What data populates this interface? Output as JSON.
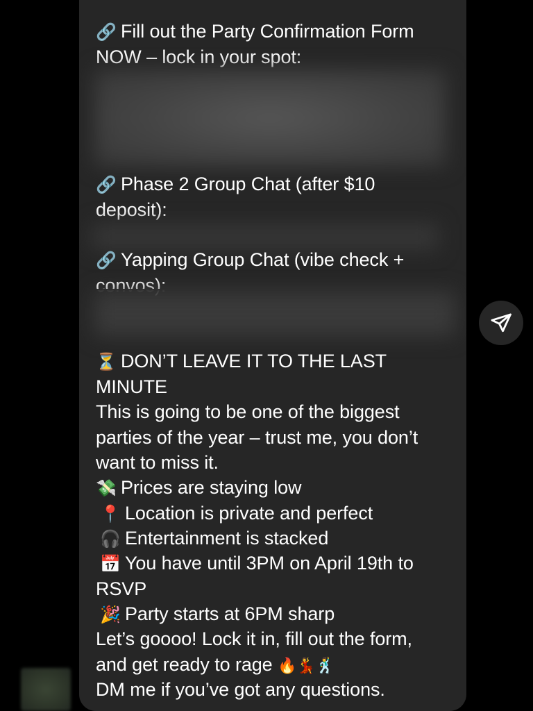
{
  "message": {
    "lines": [
      {
        "icon": "🔗",
        "text": "Fill out the Party Confirmation Form"
      },
      {
        "icon": "",
        "text": "NOW – lock in your spot:"
      },
      {
        "icon": "🔗",
        "text": "Phase 2 Group Chat (after $10"
      },
      {
        "icon": "",
        "text": "deposit):"
      },
      {
        "icon": "🔗",
        "text": "Yapping Group Chat (vibe check +"
      },
      {
        "icon": "",
        "text": "convos):"
      },
      {
        "icon": "⏳",
        "text": "DON’T LEAVE IT TO THE LAST"
      },
      {
        "icon": "",
        "text": "MINUTE"
      },
      {
        "icon": "",
        "text": "This is going to be one of the biggest"
      },
      {
        "icon": "",
        "text": "parties of the year – trust me, you don’t"
      },
      {
        "icon": "",
        "text": "want to miss it."
      },
      {
        "icon": "💸",
        "text": "Prices are staying low"
      },
      {
        "icon": "📍",
        "text": "Location is private and perfect"
      },
      {
        "icon": "🎧",
        "text": "Entertainment is stacked"
      },
      {
        "icon": "📅",
        "text": "You have until 3PM on April 19th to"
      },
      {
        "icon": "",
        "text": "RSVP"
      },
      {
        "icon": "🎉",
        "text": "Party starts at 6PM sharp"
      },
      {
        "icon": "",
        "text": "Let’s goooo! Lock it in, fill out the form,"
      },
      {
        "icon": "",
        "text": "and get ready to rage"
      },
      {
        "icon": "",
        "text": "DM me if you’ve got any questions."
      }
    ],
    "trailing_emojis": "🔥💃🕺"
  },
  "actions": {
    "share_icon": "paper-plane-icon"
  },
  "colors": {
    "background": "#000000",
    "bubble": "#262626",
    "text": "#ffffff",
    "redacted": "#444444"
  }
}
